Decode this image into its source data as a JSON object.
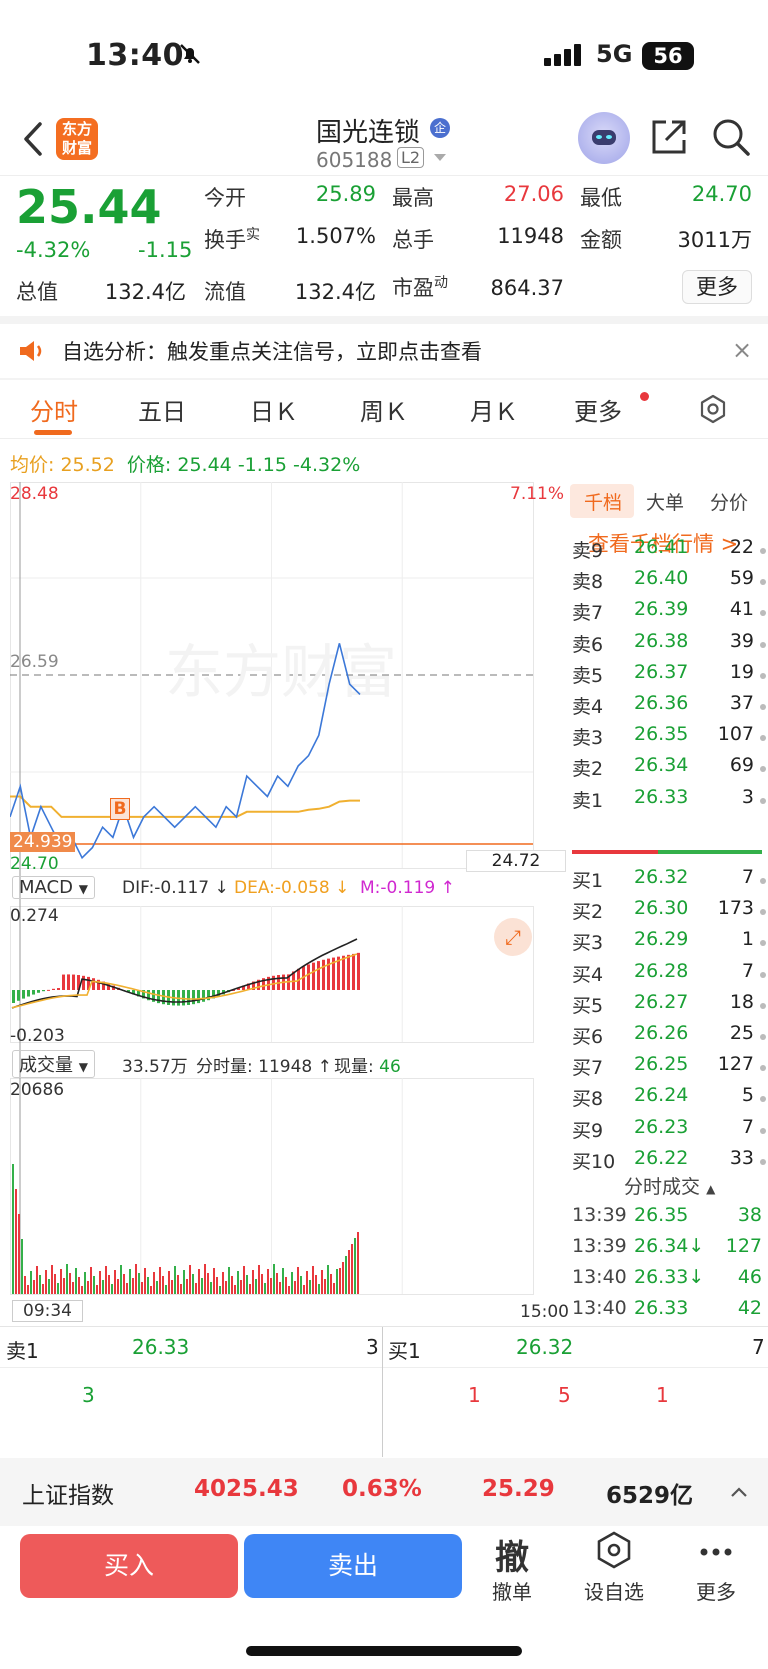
{
  "status": {
    "time": "13:40",
    "network": "5G",
    "battery": "56"
  },
  "header": {
    "logo_text": "东方财富",
    "stock_name": "国光连锁",
    "qualifier_badge": "企",
    "stock_code": "605188",
    "level": "L2"
  },
  "quote": {
    "price": "25.44",
    "change_pct": "-4.32%",
    "change": "-1.15",
    "fields": [
      {
        "label": "今开",
        "value": "25.89",
        "color": "green"
      },
      {
        "label": "最高",
        "value": "27.06",
        "color": "red"
      },
      {
        "label": "最低",
        "value": "24.70",
        "color": "green"
      },
      {
        "label": "换手",
        "label_sup": "实",
        "value": "1.507%",
        "color": "dark"
      },
      {
        "label": "总手",
        "value": "11948",
        "color": "dark"
      },
      {
        "label": "金额",
        "value": "3011万",
        "color": "dark"
      },
      {
        "label": "总值",
        "value": "132.4亿",
        "color": "dark"
      },
      {
        "label": "流值",
        "value": "132.4亿",
        "color": "dark"
      },
      {
        "label": "市盈",
        "label_sup": "动",
        "value": "864.37",
        "color": "dark"
      }
    ],
    "more_label": "更多"
  },
  "notice": {
    "text": "自选分析：触发重点关注信号，立即点击查看",
    "close": "×"
  },
  "tabs": [
    "分时",
    "五日",
    "日Ｋ",
    "周Ｋ",
    "月Ｋ",
    "更多"
  ],
  "price_line": {
    "avg_label": "均价:",
    "avg_value": "25.52",
    "price_label": "价格:",
    "price_value": "25.44",
    "change": "-1.15",
    "change_pct": "-4.32%"
  },
  "chart": {
    "y_top": "28.48",
    "y_top_pct": "7.11%",
    "prev_close": "26.59",
    "cursor_price": "24.939",
    "y_bottom": "24.70",
    "cursor_box": "24.72",
    "watermark": "东方财富",
    "marker": "B",
    "macd": {
      "name": "MACD",
      "dif": "DIF:-0.117 ↓",
      "dea": "DEA:-0.058 ↓",
      "m": "M:-0.119 ↑",
      "top": "0.274",
      "bottom": "-0.203"
    },
    "volume": {
      "name": "成交量",
      "total": "33.57万",
      "minute": "分时量: 11948 ↑",
      "now_label": "现量:",
      "now_value": "46",
      "top": "20686"
    },
    "time_start": "09:34",
    "time_end": "15:00"
  },
  "chart_data": {
    "type": "line",
    "x_range": [
      "09:30",
      "15:00"
    ],
    "ylim": [
      24.7,
      28.48
    ],
    "prev_close": 26.59,
    "series": [
      {
        "name": "价格",
        "values": [
          25.2,
          25.5,
          25.0,
          25.3,
          25.1,
          24.9,
          25.0,
          24.8,
          24.9,
          25.1,
          25.0,
          25.3,
          25.0,
          25.2,
          25.3,
          25.2,
          25.1,
          25.2,
          25.3,
          25.2,
          25.1,
          25.3,
          25.2,
          25.6,
          25.5,
          25.4,
          25.6,
          25.5,
          25.7,
          25.8,
          26.0,
          26.5,
          26.9,
          26.5,
          26.4
        ]
      },
      {
        "name": "均价",
        "values": [
          25.4,
          25.4,
          25.3,
          25.3,
          25.3,
          25.2,
          25.2,
          25.2,
          25.2,
          25.2,
          25.2,
          25.2,
          25.2,
          25.2,
          25.2,
          25.2,
          25.2,
          25.2,
          25.2,
          25.2,
          25.2,
          25.2,
          25.2,
          25.25,
          25.25,
          25.25,
          25.25,
          25.25,
          25.25,
          25.27,
          25.28,
          25.3,
          25.35,
          25.36,
          25.36
        ]
      }
    ]
  },
  "book": {
    "tabs": [
      "千档",
      "大单",
      "分价"
    ],
    "qiandang_link": "查看千档行情 >",
    "asks": [
      {
        "label": "卖9",
        "price": "26.41",
        "vol": "22"
      },
      {
        "label": "卖8",
        "price": "26.40",
        "vol": "59"
      },
      {
        "label": "卖7",
        "price": "26.39",
        "vol": "41"
      },
      {
        "label": "卖6",
        "price": "26.38",
        "vol": "39"
      },
      {
        "label": "卖5",
        "price": "26.37",
        "vol": "19"
      },
      {
        "label": "卖4",
        "price": "26.36",
        "vol": "37"
      },
      {
        "label": "卖3",
        "price": "26.35",
        "vol": "107"
      },
      {
        "label": "卖2",
        "price": "26.34",
        "vol": "69"
      },
      {
        "label": "卖1",
        "price": "26.33",
        "vol": "3"
      }
    ],
    "bids": [
      {
        "label": "买1",
        "price": "26.32",
        "vol": "7"
      },
      {
        "label": "买2",
        "price": "26.30",
        "vol": "173"
      },
      {
        "label": "买3",
        "price": "26.29",
        "vol": "1"
      },
      {
        "label": "买4",
        "price": "26.28",
        "vol": "7"
      },
      {
        "label": "买5",
        "price": "26.27",
        "vol": "18"
      },
      {
        "label": "买6",
        "price": "26.26",
        "vol": "25"
      },
      {
        "label": "买7",
        "price": "26.25",
        "vol": "127"
      },
      {
        "label": "买8",
        "price": "26.24",
        "vol": "5"
      },
      {
        "label": "买9",
        "price": "26.23",
        "vol": "7"
      },
      {
        "label": "买10",
        "price": "26.22",
        "vol": "33"
      }
    ],
    "trades_header": "分时成交",
    "trades": [
      {
        "time": "13:39",
        "price": "26.35",
        "vol": "38"
      },
      {
        "time": "13:39",
        "price": "26.34↓",
        "vol": "127"
      },
      {
        "time": "13:40",
        "price": "26.33↓",
        "vol": "46"
      },
      {
        "time": "13:40",
        "price": "26.33",
        "vol": "42"
      }
    ]
  },
  "summary": {
    "ask_label": "卖1",
    "ask_price": "26.33",
    "ask_vol": "3",
    "ask_detail": "3",
    "bid_label": "买1",
    "bid_price": "26.32",
    "bid_vol": "7",
    "bid_detail": [
      "1",
      "5",
      "1"
    ]
  },
  "index_bar": {
    "name": "上证指数",
    "value": "4025.43",
    "pct": "0.63%",
    "change": "25.29",
    "amount": "6529亿"
  },
  "actions": {
    "buy": "买入",
    "sell": "卖出",
    "cancel_icon": "撤",
    "cancel": "撤单",
    "watch": "设自选",
    "more": "更多"
  },
  "colors": {
    "up": "#e8383d",
    "down": "#1aa035",
    "accent": "#f06a1e",
    "buy": "#ee5a5a",
    "sell": "#3f86f5"
  }
}
